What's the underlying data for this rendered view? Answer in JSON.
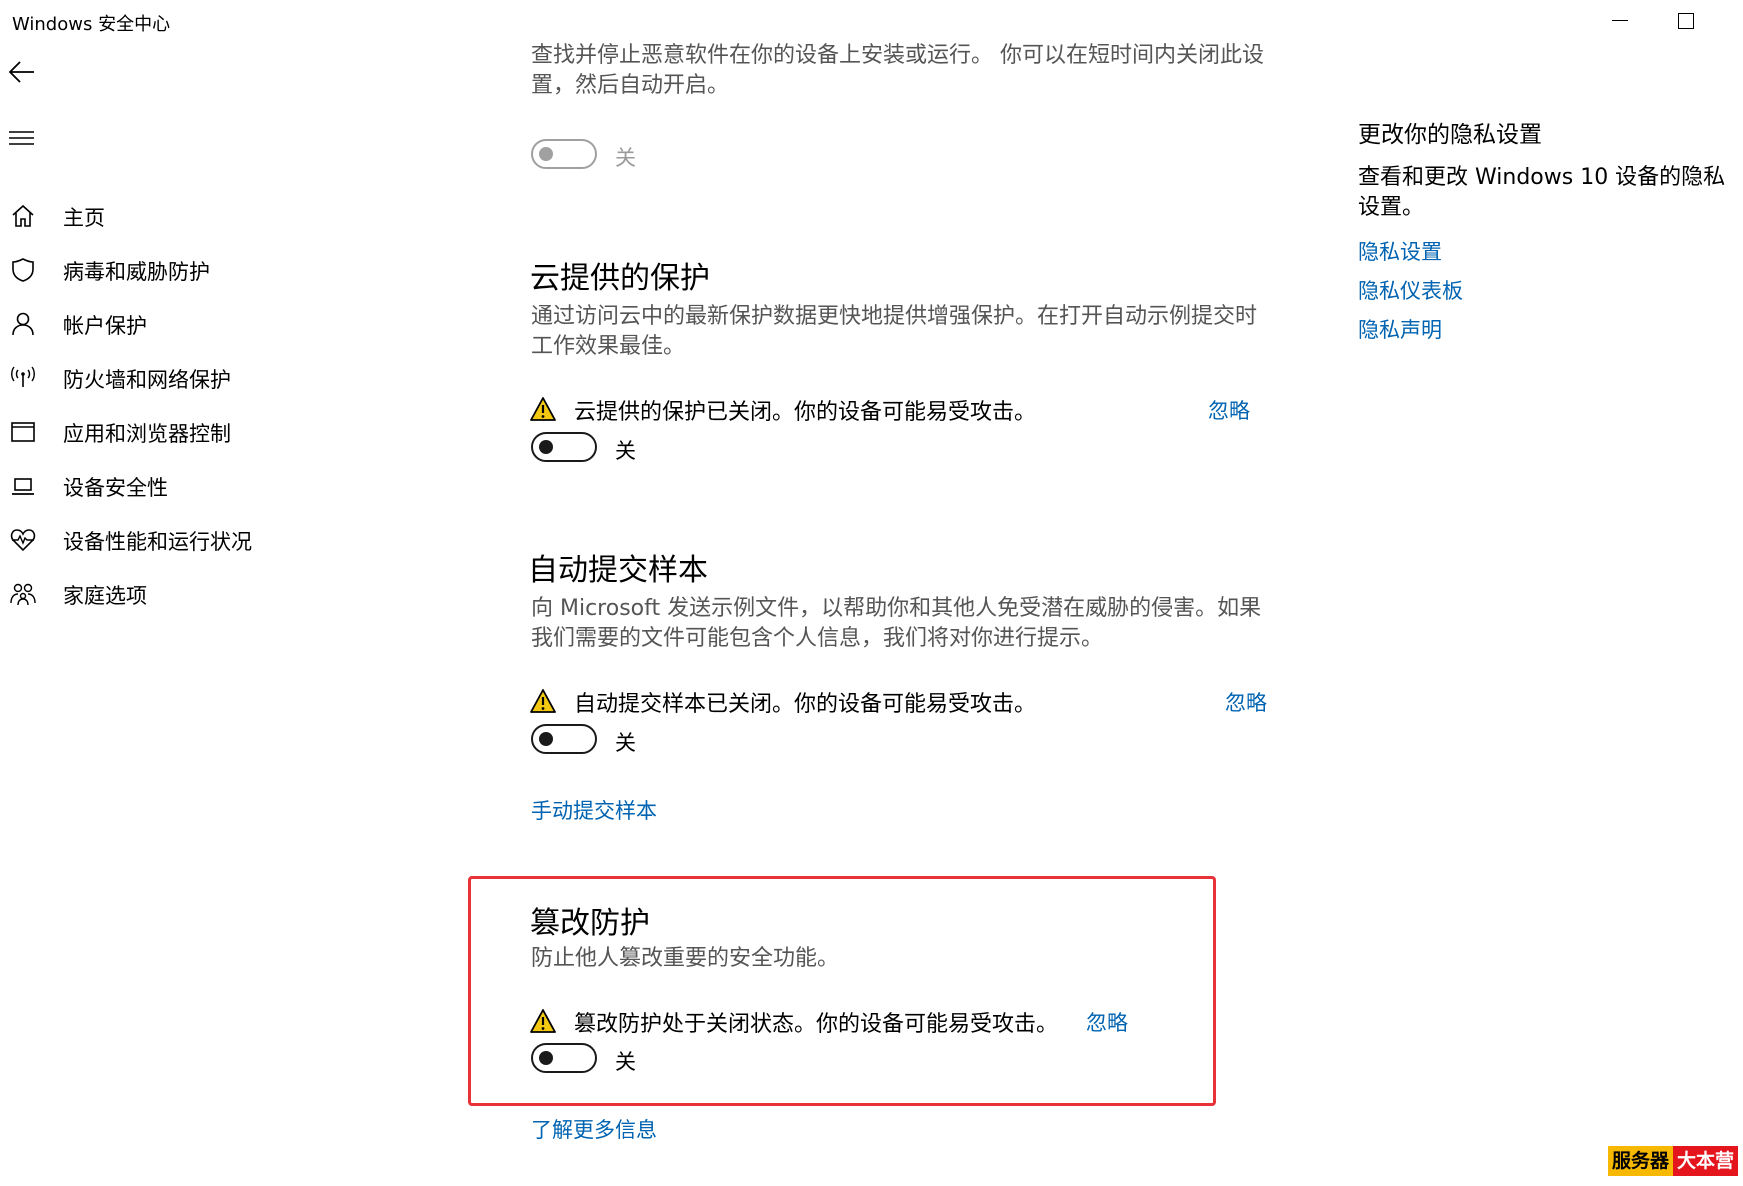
{
  "window": {
    "title": "Windows 安全中心",
    "minimize_icon": "minimize-icon",
    "maximize_icon": "maximize-icon"
  },
  "nav": {
    "back_icon": "back-arrow-icon",
    "menu_icon": "hamburger-icon",
    "items": [
      {
        "label": "主页",
        "icon": "home-icon"
      },
      {
        "label": "病毒和威胁防护",
        "icon": "shield-icon"
      },
      {
        "label": "帐户保护",
        "icon": "person-icon"
      },
      {
        "label": "防火墙和网络保护",
        "icon": "antenna-icon"
      },
      {
        "label": "应用和浏览器控制",
        "icon": "browser-window-icon"
      },
      {
        "label": "设备安全性",
        "icon": "laptop-icon"
      },
      {
        "label": "设备性能和运行状况",
        "icon": "heart-pulse-icon"
      },
      {
        "label": "家庭选项",
        "icon": "family-icon"
      }
    ]
  },
  "main": {
    "realtime": {
      "description": "查找并停止恶意软件在你的设备上安装或运行。 你可以在短时间内关闭此设置，然后自动开启。",
      "toggle_state": "关"
    },
    "cloud": {
      "title": "云提供的保护",
      "description": "通过访问云中的最新保护数据更快地提供增强保护。在打开自动示例提交时工作效果最佳。",
      "warning": "云提供的保护已关闭。你的设备可能易受攻击。",
      "ignore": "忽略",
      "toggle_state": "关"
    },
    "sample": {
      "title": "自动提交样本",
      "description": "向 Microsoft 发送示例文件，以帮助你和其他人免受潜在威胁的侵害。如果我们需要的文件可能包含个人信息，我们将对你进行提示。",
      "warning": "自动提交样本已关闭。你的设备可能易受攻击。",
      "ignore": "忽略",
      "toggle_state": "关",
      "manual_link": "手动提交样本"
    },
    "tamper": {
      "title": "篡改防护",
      "description": "防止他人篡改重要的安全功能。",
      "warning": "篡改防护处于关闭状态。你的设备可能易受攻击。",
      "ignore": "忽略",
      "toggle_state": "关",
      "learn_more": "了解更多信息"
    }
  },
  "side": {
    "title": "更改你的隐私设置",
    "description": "查看和更改 Windows 10 设备的隐私设置。",
    "links": [
      "隐私设置",
      "隐私仪表板",
      "隐私声明"
    ]
  },
  "watermark": {
    "part1": "服务器",
    "part2": "大本营"
  },
  "colors": {
    "link": "#0063b1",
    "highlight_border": "#e8323a",
    "warning_fill": "#f2c811"
  }
}
